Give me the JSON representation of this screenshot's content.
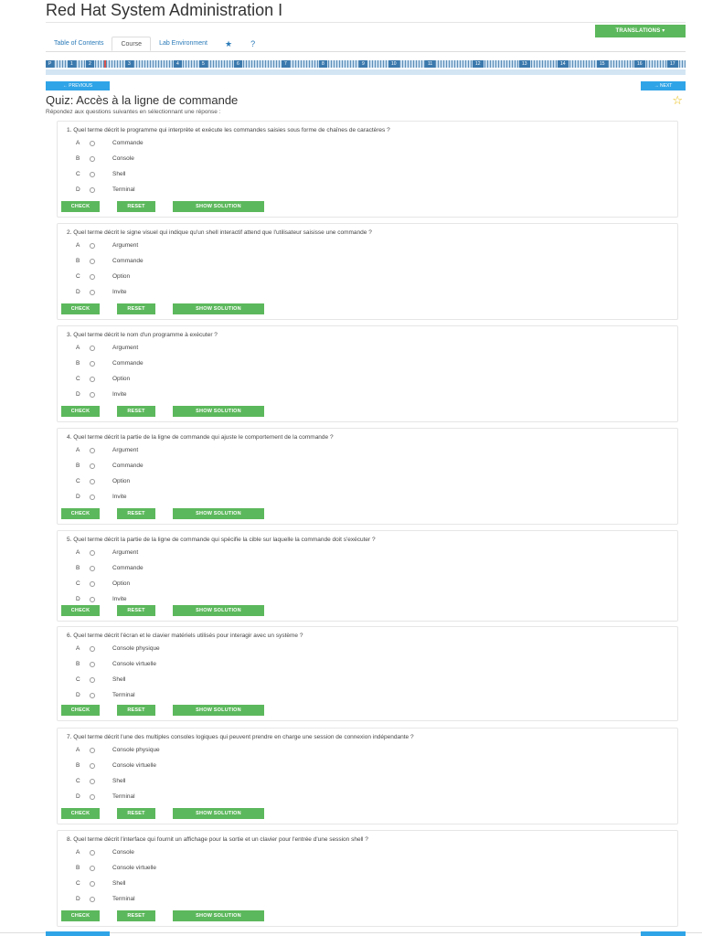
{
  "app": {
    "title": "Red Hat System Administration I",
    "translations_label": "TRANSLATIONS ▾"
  },
  "tabs": [
    {
      "label": "Table of Contents"
    },
    {
      "label": "Course"
    },
    {
      "label": "Lab Environment"
    },
    {
      "label": "★"
    },
    {
      "label": "?"
    }
  ],
  "progress": {
    "labels": [
      "P",
      "1",
      "2",
      "3",
      "4",
      "5",
      "6",
      "7",
      "8",
      "9",
      "10",
      "11",
      "12",
      "13",
      "14",
      "15",
      "16",
      "17"
    ]
  },
  "nav": {
    "previous": "← PREVIOUS",
    "next": "→ NEXT"
  },
  "quiz": {
    "title": "Quiz: Accès à la ligne de commande",
    "instructions": "Répondez aux questions suivantes en sélectionnant une réponse :",
    "buttons": {
      "check": "CHECK",
      "reset": "RESET",
      "solution": "SHOW SOLUTION"
    },
    "questions": [
      {
        "text": "1.  Quel terme décrit le programme qui interprète et exécute les commandes saisies sous forme de chaînes de caractères ?",
        "options": [
          {
            "letter": "A",
            "label": "Commande"
          },
          {
            "letter": "B",
            "label": "Console"
          },
          {
            "letter": "C",
            "label": "Shell"
          },
          {
            "letter": "D",
            "label": "Terminal"
          }
        ]
      },
      {
        "text": "2.  Quel terme décrit le signe visuel qui indique qu'un shell interactif attend que l'utilisateur saisisse une commande ?",
        "options": [
          {
            "letter": "A",
            "label": "Argument"
          },
          {
            "letter": "B",
            "label": "Commande"
          },
          {
            "letter": "C",
            "label": "Option"
          },
          {
            "letter": "D",
            "label": "Invite"
          }
        ]
      },
      {
        "text": "3.  Quel terme décrit le nom d'un programme à exécuter ?",
        "options": [
          {
            "letter": "A",
            "label": "Argument"
          },
          {
            "letter": "B",
            "label": "Commande"
          },
          {
            "letter": "C",
            "label": "Option"
          },
          {
            "letter": "D",
            "label": "Invite"
          }
        ]
      },
      {
        "text": "4.  Quel terme décrit la partie de la ligne de commande qui ajuste le comportement de la commande ?",
        "options": [
          {
            "letter": "A",
            "label": "Argument"
          },
          {
            "letter": "B",
            "label": "Commande"
          },
          {
            "letter": "C",
            "label": "Option"
          },
          {
            "letter": "D",
            "label": "Invite"
          }
        ]
      },
      {
        "text": "5.  Quel terme décrit la partie de la ligne de commande qui spécifie la cible sur laquelle la commande doit s'exécuter ?",
        "options": [
          {
            "letter": "A",
            "label": "Argument"
          },
          {
            "letter": "B",
            "label": "Commande"
          },
          {
            "letter": "C",
            "label": "Option"
          },
          {
            "letter": "D",
            "label": "Invite"
          }
        ]
      },
      {
        "text": "6.  Quel terme décrit l'écran et le clavier matériels utilisés pour interagir avec un système ?",
        "options": [
          {
            "letter": "A",
            "label": "Console physique"
          },
          {
            "letter": "B",
            "label": "Console virtuelle"
          },
          {
            "letter": "C",
            "label": "Shell"
          },
          {
            "letter": "D",
            "label": "Terminal"
          }
        ]
      },
      {
        "text": "7.  Quel terme décrit l'une des multiples consoles logiques qui peuvent prendre en charge une session de connexion indépendante ?",
        "options": [
          {
            "letter": "A",
            "label": "Console physique"
          },
          {
            "letter": "B",
            "label": "Console virtuelle"
          },
          {
            "letter": "C",
            "label": "Shell"
          },
          {
            "letter": "D",
            "label": "Terminal"
          }
        ]
      },
      {
        "text": "8.  Quel terme décrit l'interface qui fournit un affichage pour la sortie et un clavier pour l'entrée d'une session shell ?",
        "options": [
          {
            "letter": "A",
            "label": "Console"
          },
          {
            "letter": "B",
            "label": "Console virtuelle"
          },
          {
            "letter": "C",
            "label": "Shell"
          },
          {
            "letter": "D",
            "label": "Terminal"
          }
        ]
      }
    ]
  }
}
